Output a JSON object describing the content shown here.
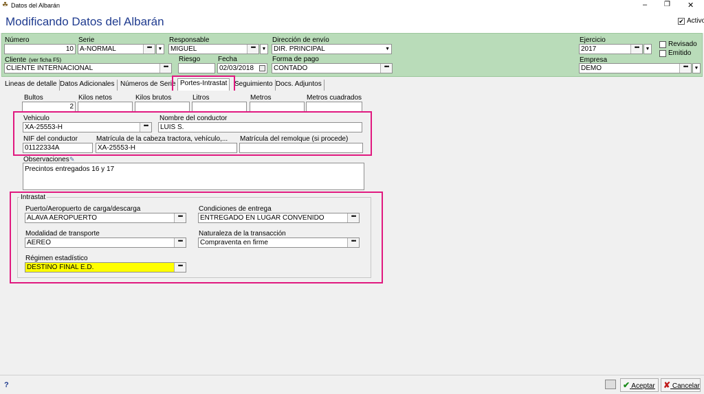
{
  "window": {
    "title": "Datos del Albarán",
    "controls": {
      "minimize": "–",
      "restore": "❐",
      "close": "✕"
    }
  },
  "header": {
    "title": "Modificando Datos del Albarán",
    "activo_label": "Activo",
    "activo_checked": "✔"
  },
  "main_fields": {
    "numero": {
      "label": "Número",
      "value": "10"
    },
    "serie": {
      "label": "Serie",
      "value": "A-NORMAL"
    },
    "responsable": {
      "label": "Responsable",
      "value": "MIGUEL"
    },
    "direccion_envio": {
      "label": "Dirección de envío",
      "value": "DIR. PRINCIPAL"
    },
    "ejercicio": {
      "label": "Ejercicio",
      "value": "2017"
    },
    "revisado": {
      "label": "Revisado"
    },
    "emitido": {
      "label": "Emitido"
    },
    "cliente": {
      "label": "Cliente",
      "hint": "(ver ficha F5)",
      "value": "CLIENTE INTERNACIONAL"
    },
    "riesgo": {
      "label": "Riesgo",
      "value": ""
    },
    "fecha": {
      "label": "Fecha",
      "value": "02/03/2018"
    },
    "forma_pago": {
      "label": "Forma de pago",
      "value": "CONTADO"
    },
    "empresa": {
      "label": "Empresa",
      "value": "DEMO"
    }
  },
  "tabs": [
    {
      "label": "Lineas de detalle"
    },
    {
      "label": "Datos Adicionales"
    },
    {
      "label": "Números de Serie"
    },
    {
      "label": "Portes-Intrastat"
    },
    {
      "label": "Seguimiento"
    },
    {
      "label": "Docs. Adjuntos"
    }
  ],
  "portes": {
    "bultos": {
      "label": "Bultos",
      "value": "2"
    },
    "kilos_netos": {
      "label": "Kilos netos",
      "value": ""
    },
    "kilos_brutos": {
      "label": "Kilos brutos",
      "value": ""
    },
    "litros": {
      "label": "Litros",
      "value": ""
    },
    "metros": {
      "label": "Metros",
      "value": ""
    },
    "metros_cuadrados": {
      "label": "Metros cuadrados",
      "value": ""
    },
    "vehiculo": {
      "label": "Vehiculo",
      "value": "XA-25553-H"
    },
    "nombre_conductor": {
      "label": "Nombre del conductor",
      "value": "LUIS S."
    },
    "nif_conductor": {
      "label": "NIF del conductor",
      "value": "01122334A"
    },
    "matricula_cabeza": {
      "label": "Matrícula de la cabeza tractora, vehículo,...",
      "value": "XA-25553-H"
    },
    "matricula_remolque": {
      "label": "Matrícula del remolque (si procede)",
      "value": ""
    },
    "observaciones": {
      "label": "Observaciones",
      "value": "Precintos entregados 16 y 17"
    }
  },
  "intrastat": {
    "group_label": "Intrastat",
    "puerto": {
      "label": "Puerto/Aeropuerto de carga/descarga",
      "value": "ALAVA AEROPUERTO"
    },
    "condiciones": {
      "label": "Condiciones de entrega",
      "value": "ENTREGADO EN LUGAR CONVENIDO"
    },
    "modalidad": {
      "label": "Modalidad de transporte",
      "value": "AEREO"
    },
    "naturaleza": {
      "label": "Naturaleza de la transacción",
      "value": "Compraventa en firme"
    },
    "regimen": {
      "label": "Régimen estadístico",
      "value": "DESTINO FINAL E.D."
    }
  },
  "footer": {
    "help": "?",
    "aceptar": "Aceptar",
    "cancelar": "Cancelar"
  },
  "colors": {
    "highlight": "#e0187f",
    "header_green": "#b9dcb9",
    "title_blue": "#1f3b8f",
    "regimen_bg": "#ffff00"
  },
  "dots_glyph": "•••",
  "dd_glyph": "▼"
}
